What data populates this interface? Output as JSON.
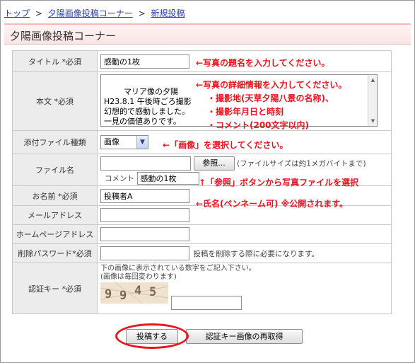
{
  "breadcrumb": {
    "top": "トップ",
    "sep1": ">",
    "corner": "夕陽画像投稿コーナー",
    "sep2": ">",
    "current": "新規投稿"
  },
  "page_title": "夕陽画像投稿コーナー",
  "form": {
    "title": {
      "label": "タイトル *必須",
      "value": "感動の1枚"
    },
    "body": {
      "label": "本文 *必須",
      "value": "マリア像の夕陽\nH23.8.1 午後時ごろ撮影\n幻想的で感動しました。\n一見の価値ありです。"
    },
    "attachment_type": {
      "label": "添付ファイル種類",
      "selected": "画像"
    },
    "file_name": {
      "label": "ファイル名",
      "browse_button": "参照...",
      "size_note": "(ファイルサイズは約1メガバイトまで)",
      "comment_label": "コメント",
      "comment_value": "感動の1枚"
    },
    "name": {
      "label": "お名前 *必須",
      "value": "投稿者A"
    },
    "email": {
      "label": "メールアドレス",
      "value": ""
    },
    "homepage": {
      "label": "ホームページアドレス",
      "value": ""
    },
    "delete_password": {
      "label": "削除パスワード*必須",
      "value": "",
      "note": "投稿を削除する際に必要になります。"
    },
    "auth_key": {
      "label": "認証キー *必須",
      "instruction1": "下の画像に表示されている数字をご記入下さい。",
      "instruction2": "(画像は毎回変わります)",
      "captcha_digits": [
        "9",
        "9",
        "4",
        "5"
      ],
      "value": ""
    }
  },
  "buttons": {
    "submit": "投稿する",
    "refresh_captcha": "認証キー画像の再取得"
  },
  "annotations": {
    "title": "←写真の題名を入力してください。",
    "body_main": "←写真の詳細情報を入力してください。",
    "body_item1": "・撮影地(天草夕陽八景の名称)、",
    "body_item2": "・撮影年月日と時刻",
    "body_item3": "・コメント(200文字以内)",
    "attachment": "←「画像」を選択してください。",
    "browse": "↑「参照」ボタンから写真ファイルを選択",
    "name": "←氏名(ペンネーム可) ※公開されます。"
  },
  "colors": {
    "annotation_red": "#e8141e",
    "link_blue": "#2a3fa8",
    "title_bar_pink": "#fbe3e3"
  }
}
